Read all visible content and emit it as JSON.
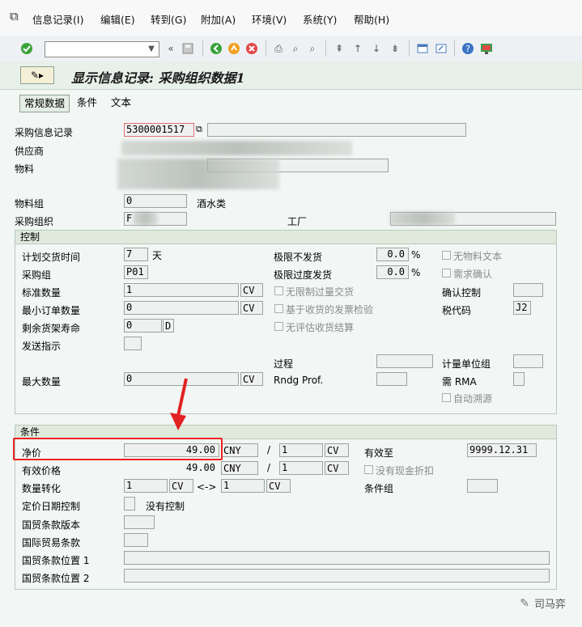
{
  "menu": [
    "信息记录(I)",
    "编辑(E)",
    "转到(G)",
    "附加(A)",
    "环境(V)",
    "系统(Y)",
    "帮助(H)"
  ],
  "title": "显示信息记录: 采购组织数据1",
  "tabs": [
    "常规数据",
    "条件",
    "文本"
  ],
  "header": {
    "info_record_label": "采购信息记录",
    "info_record_value": "5300001517",
    "vendor_label": "供应商",
    "material_label": "物料",
    "matl_group_label": "物料组",
    "matl_group_value": "0",
    "matl_group_desc": "酒水类",
    "purch_org_label": "采购组织",
    "purch_org_value": "F",
    "plant_label": "工厂"
  },
  "control": {
    "title": "控制",
    "planned_delivery_label": "计划交货时间",
    "planned_delivery_value": "7",
    "planned_delivery_unit": "天",
    "purch_group_label": "采购组",
    "purch_group_value": "P01",
    "std_qty_label": "标准数量",
    "std_qty_value": "1",
    "std_qty_unit": "CV",
    "min_qty_label": "最小订单数量",
    "min_qty_value": "0",
    "min_qty_unit": "CV",
    "shelf_life_label": "剩余货架寿命",
    "shelf_life_value": "0",
    "shelf_life_unit": "D",
    "shipping_label": "发送指示",
    "max_qty_label": "最大数量",
    "max_qty_value": "0",
    "max_qty_unit": "CV",
    "underdel_label": "极限不发货",
    "underdel_value": "0.0",
    "overdel_label": "极限过度发货",
    "overdel_value": "0.0",
    "pct": "%",
    "unlimited_label": "无限制过量交货",
    "gr_based_label": "基于收货的发票检验",
    "no_eval_label": "无评估收货结算",
    "procedure_label": "过程",
    "rndg_label": "Rndg Prof.",
    "no_text_label": "无物料文本",
    "ack_req_label": "需求确认",
    "conf_ctrl_label": "确认控制",
    "tax_code_label": "税代码",
    "tax_code_value": "J2",
    "uom_group_label": "计量单位组",
    "rma_label": "需 RMA",
    "auto_source_label": "自动溯源"
  },
  "conditions": {
    "title": "条件",
    "net_price_label": "净价",
    "net_price_value": "49.00",
    "currency": "CNY",
    "slash": "/",
    "per_qty": "1",
    "per_unit": "CV",
    "eff_price_label": "有效价格",
    "eff_price_value": "49.00",
    "valid_to_label": "有效至",
    "valid_to_value": "9999.12.31",
    "no_cash_disc_label": "没有现金折扣",
    "conv_label": "数量转化",
    "conv_from": "1",
    "conv_from_unit": "CV",
    "conv_arrow": "<->",
    "conv_to": "1",
    "conv_to_unit": "CV",
    "cond_group_label": "条件组",
    "pricing_date_label": "定价日期控制",
    "pricing_date_desc": "没有控制",
    "incoterms_ver_label": "国贸条款版本",
    "incoterms_label": "国际贸易条款",
    "incoterms_loc1_label": "国贸条款位置 1",
    "incoterms_loc2_label": "国贸条款位置 2"
  },
  "watermark": "司马弈",
  "colors": {
    "highlight": "#e22222",
    "arrow": "#e22222"
  }
}
